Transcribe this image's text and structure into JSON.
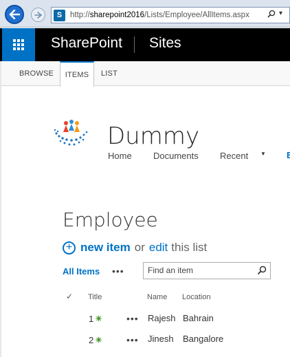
{
  "browser": {
    "url_prefix": "http://",
    "url_host": "sharepoint2016",
    "url_path": "/Lists/Employee/AllItems.aspx",
    "site_icon_letter": "S",
    "search_glyph": "⌕",
    "dropdown_glyph": "▾"
  },
  "suite": {
    "brand": "SharePoint",
    "sites": "Sites"
  },
  "ribbon": {
    "tabs": [
      "BROWSE",
      "ITEMS",
      "LIST"
    ],
    "active_tab": "ITEMS"
  },
  "site": {
    "title": "Dummy",
    "nav": [
      "Home",
      "Documents",
      "Recent"
    ],
    "nav_overflow": "E"
  },
  "list": {
    "title": "Employee",
    "new_item_label": "new item",
    "or_text": "or",
    "edit_label": "edit",
    "this_list_text": "this list",
    "view_label": "All Items",
    "ellipsis": "•••",
    "search_placeholder": "Find an item",
    "columns": {
      "check": "✓",
      "title": "Title",
      "name": "Name",
      "location": "Location"
    },
    "rows": [
      {
        "title": "1",
        "new_badge": "✳",
        "menu": "•••",
        "name": "Rajesh",
        "location": "Bahrain"
      },
      {
        "title": "2",
        "new_badge": "✳",
        "menu": "•••",
        "name": "Jinesh",
        "location": "Bangalore"
      }
    ]
  },
  "colors": {
    "accent": "#0072c6",
    "suite_bar": "#000000",
    "new_badge": "#3b8f1e"
  }
}
